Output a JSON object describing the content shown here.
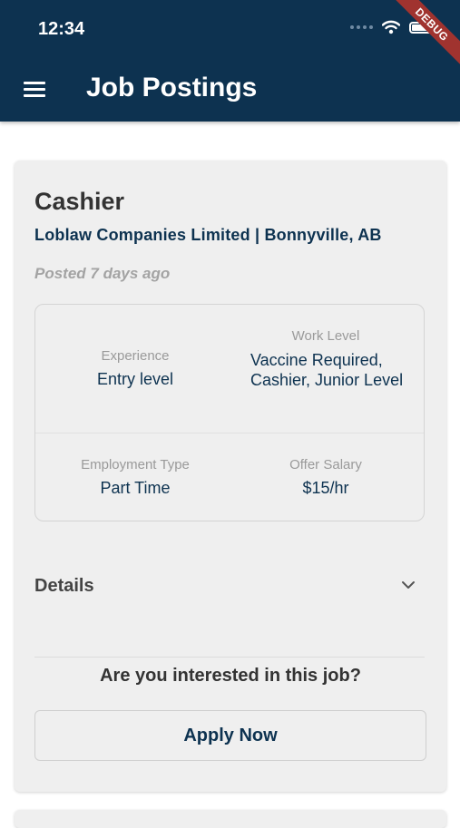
{
  "status_bar": {
    "time": "12:34",
    "icons": [
      "cellular-signal-icon",
      "wifi-icon",
      "battery-icon"
    ]
  },
  "debug_banner": "DEBUG",
  "app_bar": {
    "menu_icon": "hamburger-menu-icon",
    "title": "Job Postings"
  },
  "job": {
    "title": "Cashier",
    "company_location": "Loblaw Companies Limited | Bonnyville, AB",
    "posted": "Posted 7 days ago",
    "experience_label": "Experience",
    "experience_value": "Entry level",
    "work_level_label": "Work Level",
    "work_level_value": "Vaccine Required, Cashier, Junior Level",
    "employment_type_label": "Employment Type",
    "employment_type_value": "Part Time",
    "offer_salary_label": "Offer Salary",
    "offer_salary_value": "$15/hr",
    "details_label": "Details",
    "interest_question": "Are you interested in this job?",
    "apply_label": "Apply Now"
  },
  "colors": {
    "app_bar": "#0d3250",
    "accent_text": "#0d3250",
    "card_background": "#efefef",
    "debug_ribbon": "#a0332f"
  }
}
